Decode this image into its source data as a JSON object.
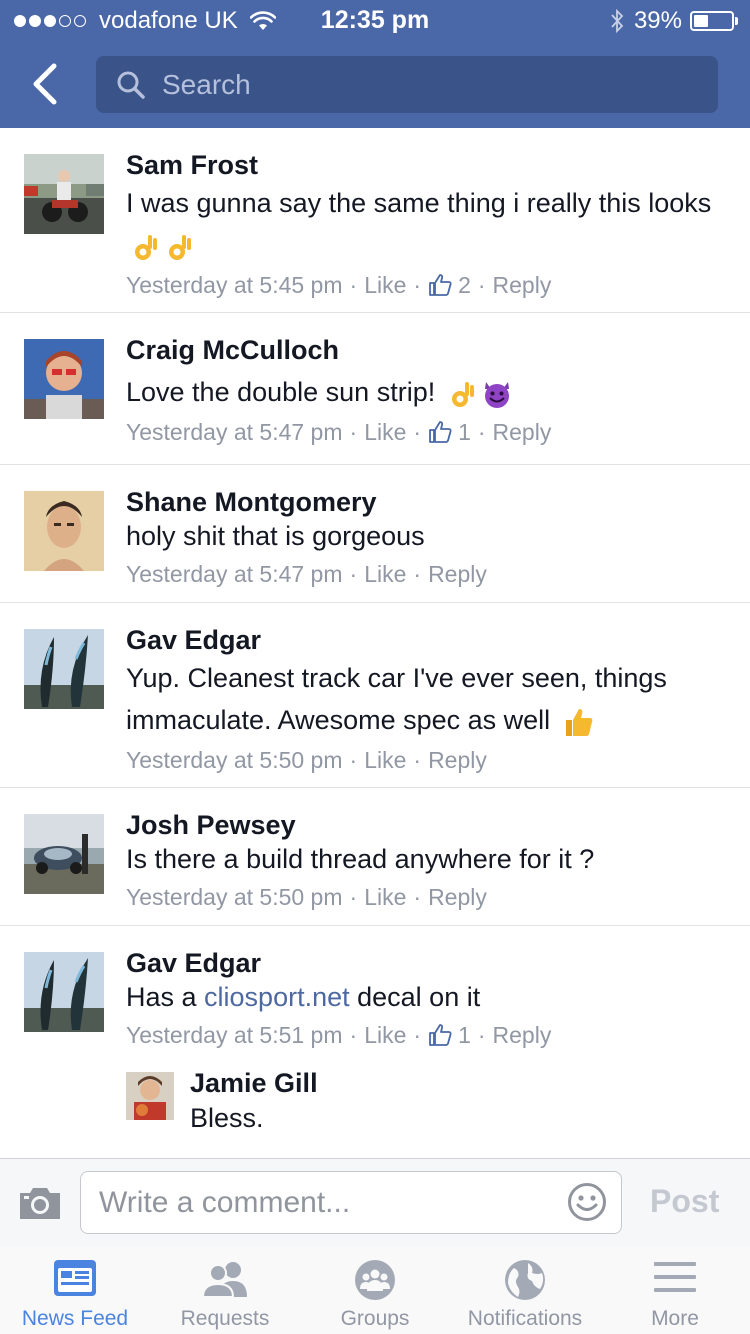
{
  "status_bar": {
    "carrier": "vodafone UK",
    "time": "12:35 pm",
    "battery": "39%",
    "battery_level": 0.39
  },
  "header": {
    "search_placeholder": "Search"
  },
  "comments": [
    {
      "name": "Sam Frost",
      "text": "I was gunna say the same thing i really this looks",
      "emoji": [
        "ok-hand-emoji",
        "ok-hand-emoji"
      ],
      "time": "Yesterday at 5:45 pm",
      "like": "Like",
      "likes": "2",
      "reply": "Reply"
    },
    {
      "name": "Craig McCulloch",
      "text": "Love the double sun strip!",
      "emoji": [
        "ok-hand-emoji",
        "smiling-devil-emoji"
      ],
      "time": "Yesterday at 5:47 pm",
      "like": "Like",
      "likes": "1",
      "reply": "Reply"
    },
    {
      "name": "Shane Montgomery",
      "text": "holy shit that is gorgeous",
      "time": "Yesterday at 5:47 pm",
      "like": "Like",
      "reply": "Reply"
    },
    {
      "name": "Gav Edgar",
      "text": "Yup. Cleanest track car I've ever seen, things immaculate. Awesome spec as well",
      "emoji": [
        "thumbs-up-emoji"
      ],
      "time": "Yesterday at 5:50 pm",
      "like": "Like",
      "reply": "Reply"
    },
    {
      "name": "Josh Pewsey",
      "text": "Is there a build thread anywhere for it ?",
      "time": "Yesterday at 5:50 pm",
      "like": "Like",
      "reply": "Reply"
    },
    {
      "name": "Gav Edgar",
      "text_before": "Has a ",
      "link": "cliosport.net",
      "text_after": " decal on it",
      "time": "Yesterday at 5:51 pm",
      "like": "Like",
      "likes": "1",
      "reply": "Reply",
      "replies": [
        {
          "name": "Jamie Gill",
          "text": "Bless."
        }
      ]
    }
  ],
  "composer": {
    "placeholder": "Write a comment...",
    "post": "Post"
  },
  "tabs": [
    {
      "label": "News Feed",
      "icon": "news-feed-icon",
      "active": true
    },
    {
      "label": "Requests",
      "icon": "friend-requests-icon"
    },
    {
      "label": "Groups",
      "icon": "groups-icon"
    },
    {
      "label": "Notifications",
      "icon": "globe-icon"
    },
    {
      "label": "More",
      "icon": "menu-icon"
    }
  ],
  "colors": {
    "header_bg": "#4a67a8",
    "search_bg": "#3a5388",
    "link": "#4e69a2",
    "meta": "#9197a3",
    "tab_active": "#4a84e0"
  }
}
